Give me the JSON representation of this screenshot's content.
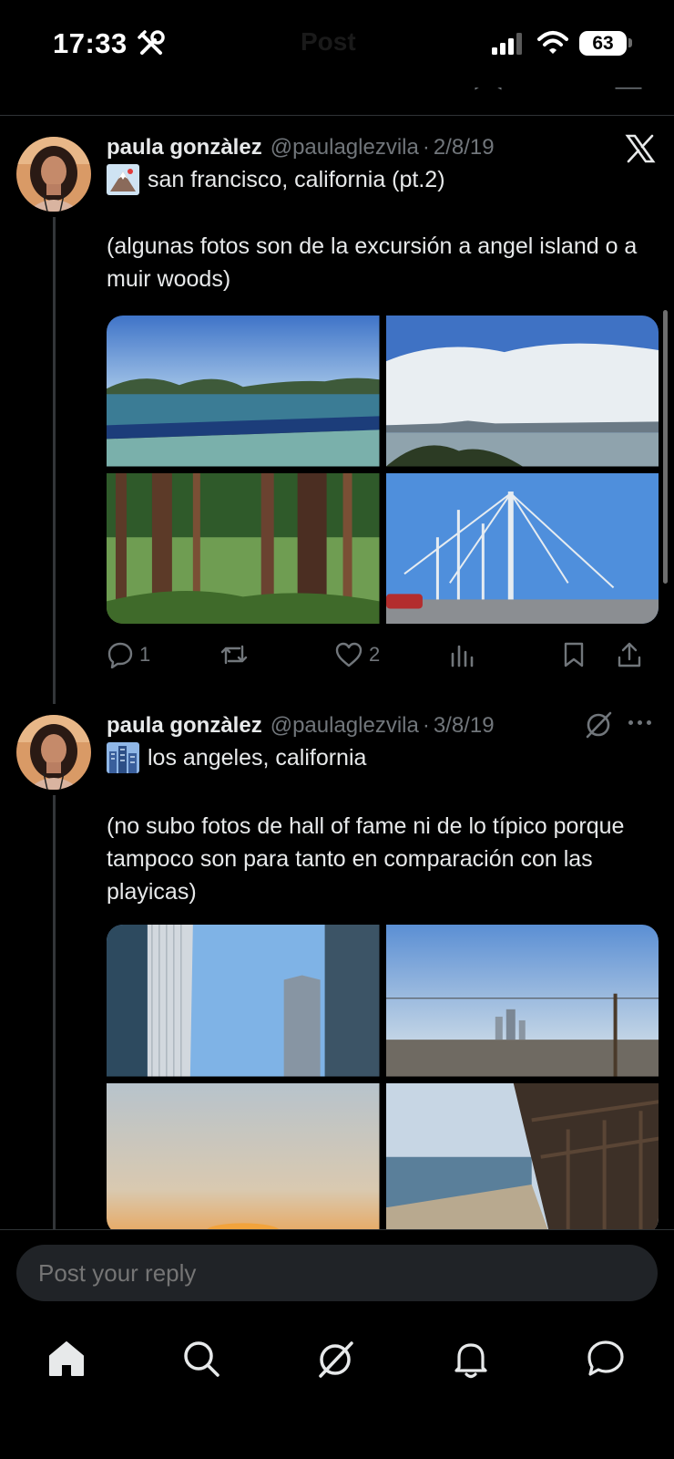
{
  "status_bar": {
    "time": "17:33",
    "faded_title": "Post",
    "battery": "63"
  },
  "colors": {
    "background": "#000000",
    "text_primary": "#e7e9ea",
    "text_secondary": "#71767b",
    "divider": "#2f3336"
  },
  "posts": [
    {
      "author_name": "paula gonzàlez",
      "handle": "@paulaglezvila",
      "separator": "·",
      "date": "2/8/19",
      "title_emoji": "mount-fuji-emoji",
      "title": "san francisco, california (pt.2)",
      "body": "(algunas fotos son de la excursión a angel island o a muir woods)",
      "media": [
        "bay-water-photo",
        "fog-skyline-photo",
        "redwood-forest-photo",
        "bay-bridge-photo"
      ],
      "actions": {
        "replies": "1",
        "reposts": "",
        "likes": "2"
      }
    },
    {
      "author_name": "paula gonzàlez",
      "handle": "@paulaglezvila",
      "separator": "·",
      "date": "3/8/19",
      "title_emoji": "cityscape-emoji",
      "title": "los angeles, california",
      "body": "(no subo fotos de hall of fame ni de lo típico porque tampoco son para tanto en comparación con las playicas)",
      "media": [
        "skyscrapers-photo",
        "la-skyline-photo",
        "sunset-photo",
        "beach-pier-photo"
      ]
    }
  ],
  "reply": {
    "placeholder": "Post your reply"
  },
  "nav": [
    "home-icon",
    "search-icon",
    "grok-icon",
    "notifications-icon",
    "messages-icon"
  ]
}
